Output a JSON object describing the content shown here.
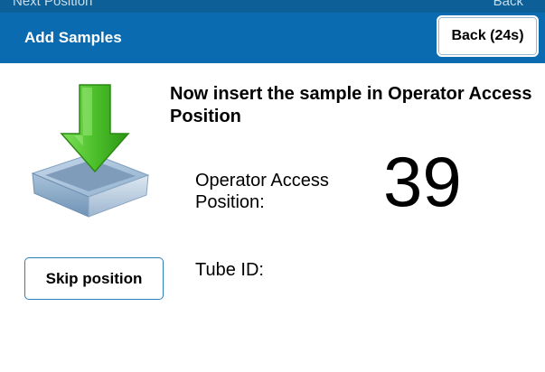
{
  "background_strip": {
    "left_text": "Next Position",
    "right_text": "Back"
  },
  "titlebar": {
    "title": "Add Samples",
    "back_label": "Back (24s)"
  },
  "main": {
    "heading": "Now insert the sample in Operator Access Position",
    "position_label": "Operator Access Position:",
    "position_value": "39",
    "tube_id_label": "Tube ID:",
    "skip_label": "Skip position",
    "illustration_icon": "insert-into-tray-icon"
  },
  "colors": {
    "titlebar": "#0b6bb0",
    "arrow_green": "#4cbf2a",
    "tray_blue": "#8fb0cf"
  }
}
